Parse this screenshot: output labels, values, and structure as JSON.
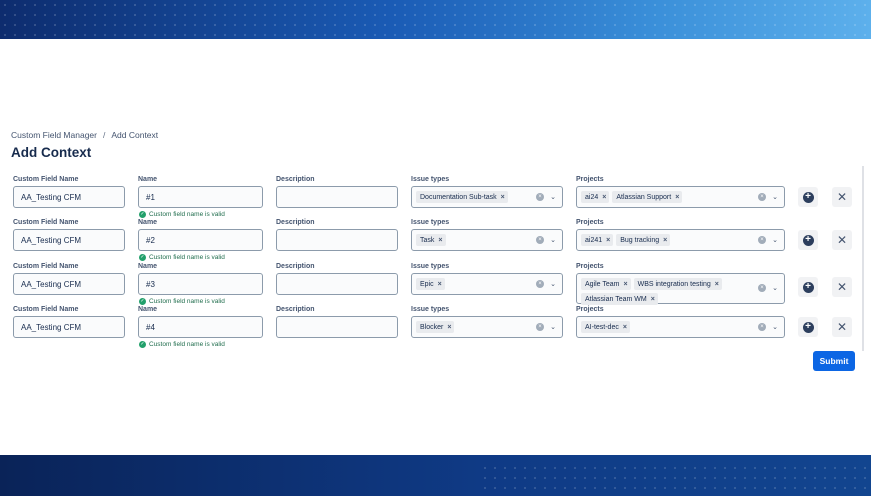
{
  "breadcrumb": {
    "parent": "Custom Field Manager",
    "separator": "/",
    "current": "Add Context"
  },
  "page_title": "Add Context",
  "labels": {
    "custom_field_name": "Custom Field Name",
    "name": "Name",
    "description": "Description",
    "issue_types": "Issue types",
    "projects": "Projects"
  },
  "validation_message": "Custom field name is valid",
  "icons": {
    "remove_tag": "×",
    "clear": "×",
    "chevron": "⌄",
    "add": "+",
    "delete": "✕",
    "check": "✓"
  },
  "rows": [
    {
      "custom_field_name": "AA_Testing CFM",
      "name": "#1",
      "description": "",
      "issue_types": [
        "Documentation Sub-task"
      ],
      "projects": [
        "ai24",
        "Atlassian Support"
      ]
    },
    {
      "custom_field_name": "AA_Testing CFM",
      "name": "#2",
      "description": "",
      "issue_types": [
        "Task"
      ],
      "projects": [
        "ai241",
        "Bug tracking"
      ]
    },
    {
      "custom_field_name": "AA_Testing CFM",
      "name": "#3",
      "description": "",
      "issue_types": [
        "Epic"
      ],
      "projects": [
        "Agile Team",
        "WBS integration testing",
        "Atlassian Team WM"
      ]
    },
    {
      "custom_field_name": "AA_Testing CFM",
      "name": "#4",
      "description": "",
      "issue_types": [
        "Blocker"
      ],
      "projects": [
        "AI-test-dec"
      ]
    }
  ],
  "submit_label": "Submit",
  "colors": {
    "primary": "#0c66e4",
    "valid": "#216e4e",
    "title": "#172b4d"
  }
}
